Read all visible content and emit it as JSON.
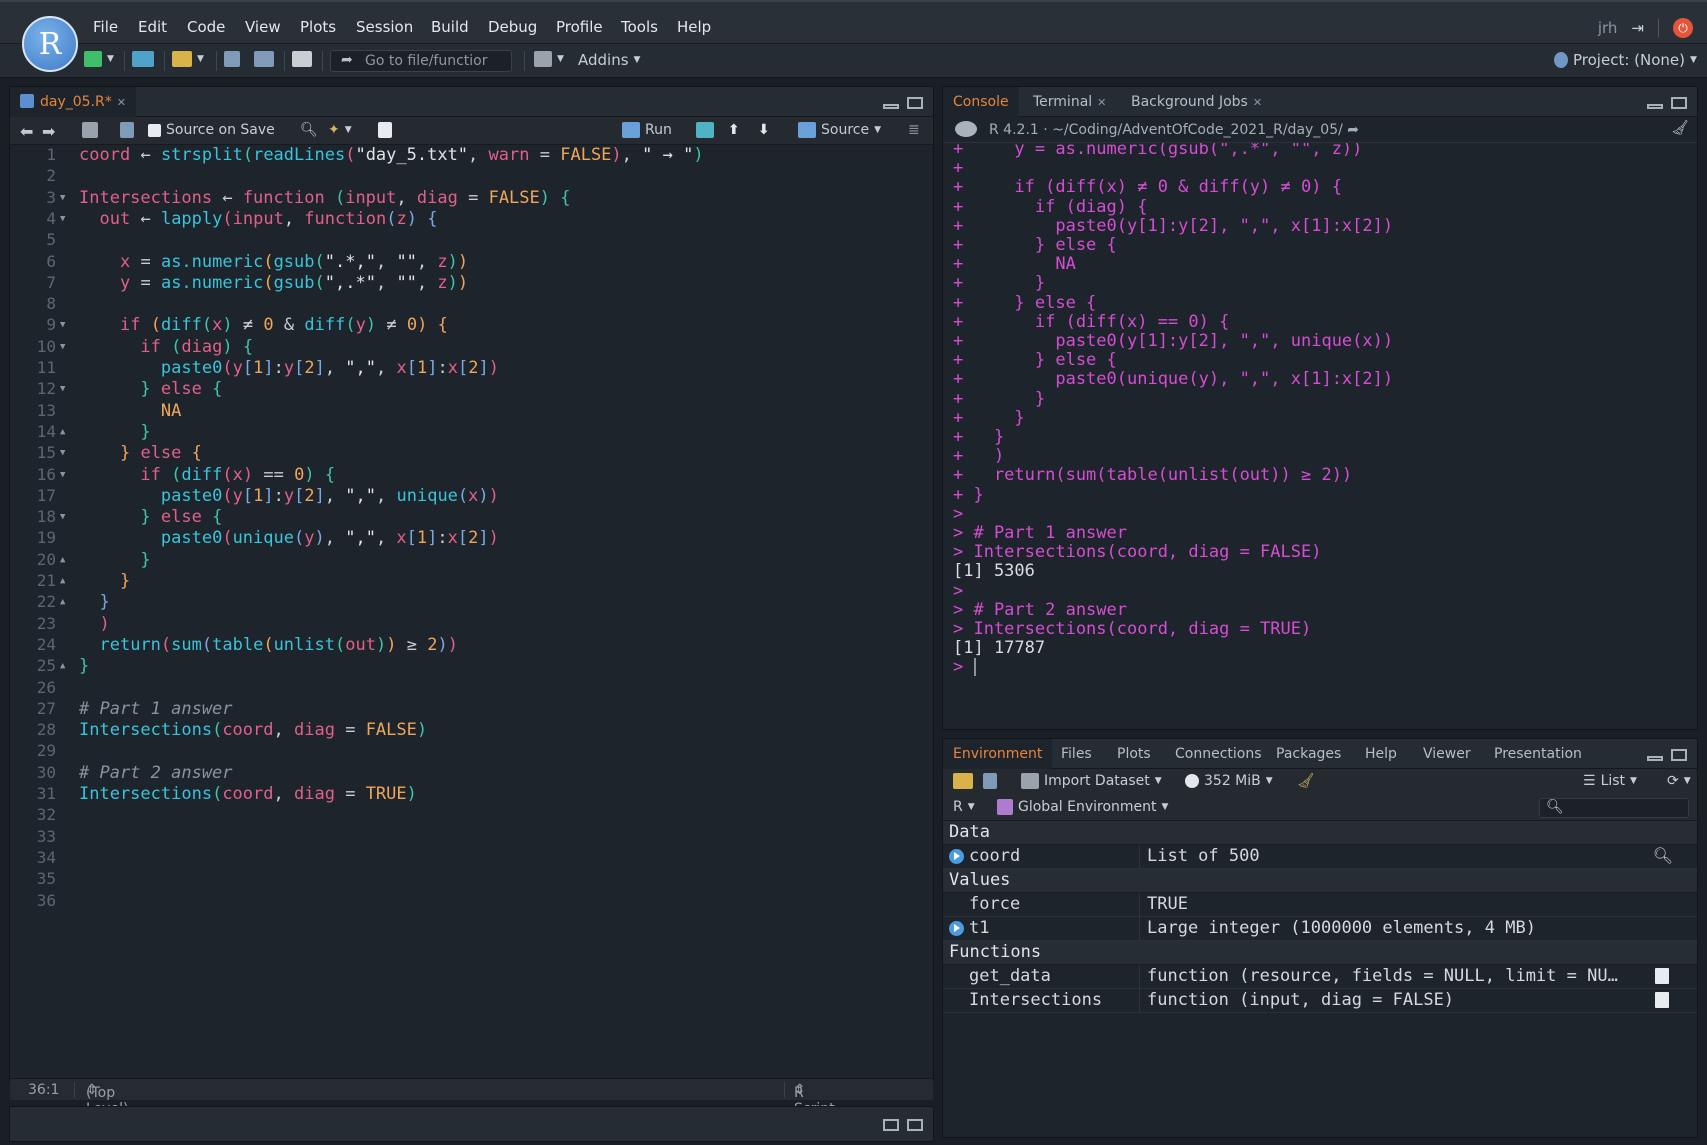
{
  "app": {
    "logo": "R"
  },
  "menu": [
    "File",
    "Edit",
    "Code",
    "View",
    "Plots",
    "Session",
    "Build",
    "Debug",
    "Profile",
    "Tools",
    "Help"
  ],
  "user": "jrh",
  "toolbar": {
    "goto_placeholder": "Go to file/functior",
    "addins": "Addins",
    "project": "Project: (None)"
  },
  "source": {
    "tab": "day_05.R*",
    "source_on_save": "Source on Save",
    "run": "Run",
    "source_btn": "Source",
    "status_pos": "36:1",
    "status_scope": "(Top Level)",
    "status_type": "R Script",
    "line_numbers": [
      "1",
      "2",
      "3",
      "4",
      "5",
      "6",
      "7",
      "8",
      "9",
      "10",
      "11",
      "12",
      "13",
      "14",
      "15",
      "16",
      "17",
      "18",
      "19",
      "20",
      "21",
      "22",
      "23",
      "24",
      "25",
      "26",
      "27",
      "28",
      "29",
      "30",
      "31",
      "32",
      "33",
      "34",
      "35",
      "36"
    ]
  },
  "console": {
    "tabs": [
      "Console",
      "Terminal",
      "Background Jobs"
    ],
    "r_version": "R 4.2.1",
    "path": "~/Coding/AdventOfCode_2021_R/day_05/",
    "lines": [
      "+     y = as.numeric(gsub(\",.*\", \"\", z))",
      "+",
      "+     if (diff(x) ≠ 0 & diff(y) ≠ 0) {",
      "+       if (diag) {",
      "+         paste0(y[1]:y[2], \",\", x[1]:x[2])",
      "+       } else {",
      "+         NA",
      "+       }",
      "+     } else {",
      "+       if (diff(x) == 0) {",
      "+         paste0(y[1]:y[2], \",\", unique(x))",
      "+       } else {",
      "+         paste0(unique(y), \",\", x[1]:x[2])",
      "+       }",
      "+     }",
      "+   }",
      "+   )",
      "+   return(sum(table(unlist(out)) ≥ 2))",
      "+ }",
      ">",
      "> # Part 1 answer",
      "> Intersections(coord, diag = FALSE)",
      "[1] 5306",
      ">",
      "> # Part 2 answer",
      "> Intersections(coord, diag = TRUE)",
      "[1] 17787",
      ">"
    ]
  },
  "environment": {
    "tabs": [
      "Environment",
      "Files",
      "Plots",
      "Connections",
      "Packages",
      "Help",
      "Viewer",
      "Presentation"
    ],
    "import": "Import Dataset",
    "memory": "352 MiB",
    "view_mode": "List",
    "lang": "R",
    "scope": "Global Environment",
    "sections": [
      {
        "title": "Data",
        "rows": [
          {
            "name": "coord",
            "value": "List of  500"
          }
        ]
      },
      {
        "title": "Values",
        "rows": [
          {
            "name": "force",
            "value": "TRUE"
          },
          {
            "name": "t1",
            "value": "Large integer (1000000 elements,  4 MB)"
          }
        ]
      },
      {
        "title": "Functions",
        "rows": [
          {
            "name": "get_data",
            "value": "function (resource, fields = NULL, limit = NU…"
          },
          {
            "name": "Intersections",
            "value": "function (input, diag = FALSE)"
          }
        ]
      }
    ]
  },
  "colors": {
    "accent": "#e8843c",
    "console_text": "#d44dd2",
    "keyword": "#e1608a",
    "function": "#38c4d9",
    "number": "#f0a65a"
  }
}
